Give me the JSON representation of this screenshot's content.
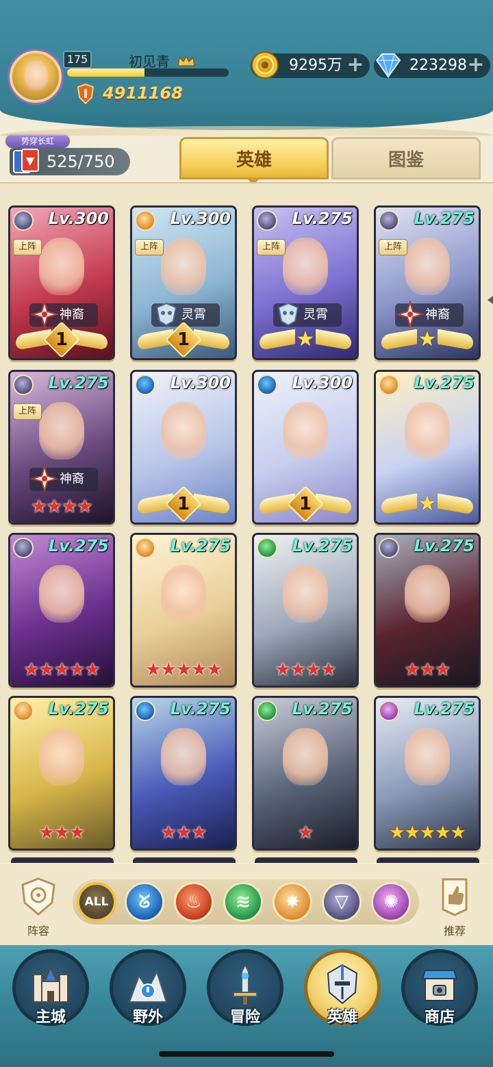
{
  "player": {
    "level": "175",
    "name": "初见青",
    "avatar_title": "势穿长虹",
    "power": "4911168",
    "exp_progress": 0.48
  },
  "resources": {
    "gold": "9295万",
    "gems": "223298"
  },
  "hero_count": "525/750",
  "tabs": {
    "heroes": "英雄",
    "codex": "图鉴"
  },
  "heroes": [
    {
      "level": "Lv.300",
      "level_color": "white",
      "faction": "dark",
      "deployed": "上阵",
      "tag": "神裔",
      "tag_icon": "divine-icon",
      "rank": {
        "type": "wing",
        "text": "1"
      },
      "palette": [
        "#f2a7b8",
        "#c33a4e",
        "#5a1020"
      ]
    },
    {
      "level": "Lv.300",
      "level_color": "white",
      "faction": "light",
      "deployed": "上阵",
      "tag": "灵霄",
      "tag_icon": "celestial-icon",
      "rank": {
        "type": "wing",
        "text": "1"
      },
      "palette": [
        "#cfe6f4",
        "#8eb6d4",
        "#3a5a7a"
      ]
    },
    {
      "level": "Lv.275",
      "level_color": "white",
      "faction": "dark",
      "deployed": "上阵",
      "tag": "灵霄",
      "tag_icon": "celestial-icon",
      "rank": {
        "type": "wing-star",
        "text": "★"
      },
      "palette": [
        "#c9c1f2",
        "#7c6fd0",
        "#302a70"
      ]
    },
    {
      "level": "Lv.275",
      "level_color": "cyan",
      "faction": "dark",
      "deployed": "上阵",
      "tag": "神裔",
      "tag_icon": "divine-icon",
      "rank": {
        "type": "wing-star",
        "text": "★"
      },
      "palette": [
        "#dfe3f5",
        "#8a95c8",
        "#2e3660"
      ]
    },
    {
      "level": "Lv.275",
      "level_color": "cyan",
      "faction": "dark",
      "deployed": "上阵",
      "tag": "神裔",
      "tag_icon": "divine-icon",
      "rank": {
        "type": "stars-red",
        "text": "★★★★"
      },
      "palette": [
        "#d8b8dc",
        "#6a4a7e",
        "#1e1428"
      ]
    },
    {
      "level": "Lv.300",
      "level_color": "white",
      "faction": "water",
      "deployed": "",
      "tag": "",
      "tag_icon": "",
      "rank": {
        "type": "wing",
        "text": "1"
      },
      "palette": [
        "#f1f3fb",
        "#b8c6e8",
        "#6c84c6"
      ]
    },
    {
      "level": "Lv.300",
      "level_color": "white",
      "faction": "water",
      "deployed": "",
      "tag": "",
      "tag_icon": "",
      "rank": {
        "type": "wing",
        "text": "1"
      },
      "palette": [
        "#eef2fb",
        "#c7cdee",
        "#8b86c8"
      ]
    },
    {
      "level": "Lv.275",
      "level_color": "cyan",
      "faction": "light",
      "deployed": "",
      "tag": "",
      "tag_icon": "",
      "rank": {
        "type": "wing-star",
        "text": "★"
      },
      "palette": [
        "#fff1c2",
        "#c9d2f2",
        "#4a5aa0"
      ]
    },
    {
      "level": "Lv.275",
      "level_color": "cyan",
      "faction": "dark",
      "deployed": "",
      "tag": "",
      "tag_icon": "",
      "rank": {
        "type": "stars-red",
        "text": "★★★★★"
      },
      "palette": [
        "#c28ad6",
        "#6a2f8c",
        "#241036"
      ]
    },
    {
      "level": "Lv.275",
      "level_color": "cyan",
      "faction": "light",
      "deployed": "",
      "tag": "",
      "tag_icon": "",
      "rank": {
        "type": "stars-red",
        "text": "★★★★★"
      },
      "palette": [
        "#fff4d6",
        "#e9cf9a",
        "#b08a5a"
      ]
    },
    {
      "level": "Lv.275",
      "level_color": "cyan",
      "faction": "wind",
      "deployed": "",
      "tag": "",
      "tag_icon": "",
      "rank": {
        "type": "stars-red",
        "text": "★★★★"
      },
      "palette": [
        "#eef2f6",
        "#9ea8b8",
        "#2a2f3c"
      ]
    },
    {
      "level": "Lv.275",
      "level_color": "cyan",
      "faction": "dark",
      "deployed": "",
      "tag": "",
      "tag_icon": "",
      "rank": {
        "type": "stars-red",
        "text": "★★★"
      },
      "palette": [
        "#a7b0bf",
        "#5a2430",
        "#161820"
      ]
    },
    {
      "level": "Lv.275",
      "level_color": "cyan",
      "faction": "light",
      "deployed": "",
      "tag": "",
      "tag_icon": "",
      "rank": {
        "type": "stars-red",
        "text": "★★★"
      },
      "palette": [
        "#fff0a8",
        "#d8b64a",
        "#6a5a2a"
      ]
    },
    {
      "level": "Lv.275",
      "level_color": "cyan",
      "faction": "water",
      "deployed": "",
      "tag": "",
      "tag_icon": "",
      "rank": {
        "type": "stars-red",
        "text": "★★★"
      },
      "palette": [
        "#b8d8e8",
        "#4a5ab8",
        "#1a2050"
      ]
    },
    {
      "level": "Lv.275",
      "level_color": "cyan",
      "faction": "wind",
      "deployed": "",
      "tag": "",
      "tag_icon": "",
      "rank": {
        "type": "stars-red",
        "text": "★"
      },
      "palette": [
        "#c9ced8",
        "#5a6478",
        "#1a1e28"
      ]
    },
    {
      "level": "Lv.275",
      "level_color": "cyan",
      "faction": "void",
      "deployed": "",
      "tag": "",
      "tag_icon": "",
      "rank": {
        "type": "stars-gold",
        "text": "★★★★★"
      },
      "palette": [
        "#e6ecf6",
        "#8a9ab8",
        "#2e3648"
      ]
    }
  ],
  "filter": {
    "lineup_label": "阵容",
    "all_label": "ALL",
    "recommend_label": "推荐",
    "factions": [
      {
        "name": "water",
        "glyph": "ᘜ"
      },
      {
        "name": "fire",
        "glyph": "♨"
      },
      {
        "name": "wind",
        "glyph": "≋"
      },
      {
        "name": "light",
        "glyph": "✸"
      },
      {
        "name": "dark",
        "glyph": "▽"
      },
      {
        "name": "void",
        "glyph": "✺"
      }
    ]
  },
  "nav": [
    {
      "label": "主城",
      "icon": "castle-icon",
      "active": false
    },
    {
      "label": "野外",
      "icon": "wilderness-icon",
      "active": false
    },
    {
      "label": "冒险",
      "icon": "adventure-icon",
      "active": false
    },
    {
      "label": "英雄",
      "icon": "hero-helmet-icon",
      "active": true
    },
    {
      "label": "商店",
      "icon": "shop-icon",
      "active": false
    }
  ]
}
